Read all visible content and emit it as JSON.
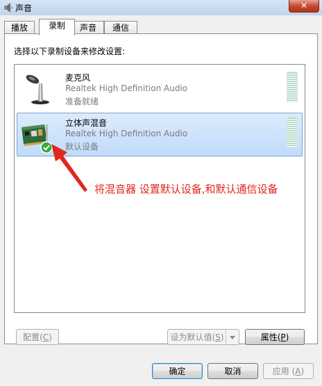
{
  "window": {
    "title": "声音",
    "close_glyph": "✕"
  },
  "tabs": [
    {
      "label": "播放"
    },
    {
      "label": "录制"
    },
    {
      "label": "声音"
    },
    {
      "label": "通信"
    }
  ],
  "active_tab": "录制",
  "panel": {
    "instruction": "选择以下录制设备来修改设置:"
  },
  "devices": [
    {
      "name": "麦克风",
      "driver": "Realtek High Definition Audio",
      "status": "准备就绪",
      "icon": "microphone-icon",
      "selected": false
    },
    {
      "name": "立体声混音",
      "driver": "Realtek High Definition Audio",
      "status": "默认设备",
      "icon": "sound-card-icon",
      "selected": true,
      "default_badge": "check-icon"
    }
  ],
  "annotation": {
    "text": "将混音器 设置默认设备,和默认通信设备",
    "color": "#e1261c"
  },
  "panel_buttons": {
    "configure": {
      "text": "配置(",
      "key": "C",
      "end": ")"
    },
    "set_default": {
      "text": "设为默认值(",
      "key": "S",
      "end": ")"
    },
    "properties": {
      "text": "属性(",
      "key": "P",
      "end": ")"
    }
  },
  "dialog_buttons": {
    "ok": "确定",
    "cancel": "取消",
    "apply": {
      "text": "应用 (",
      "key": "A",
      "end": ")"
    }
  }
}
